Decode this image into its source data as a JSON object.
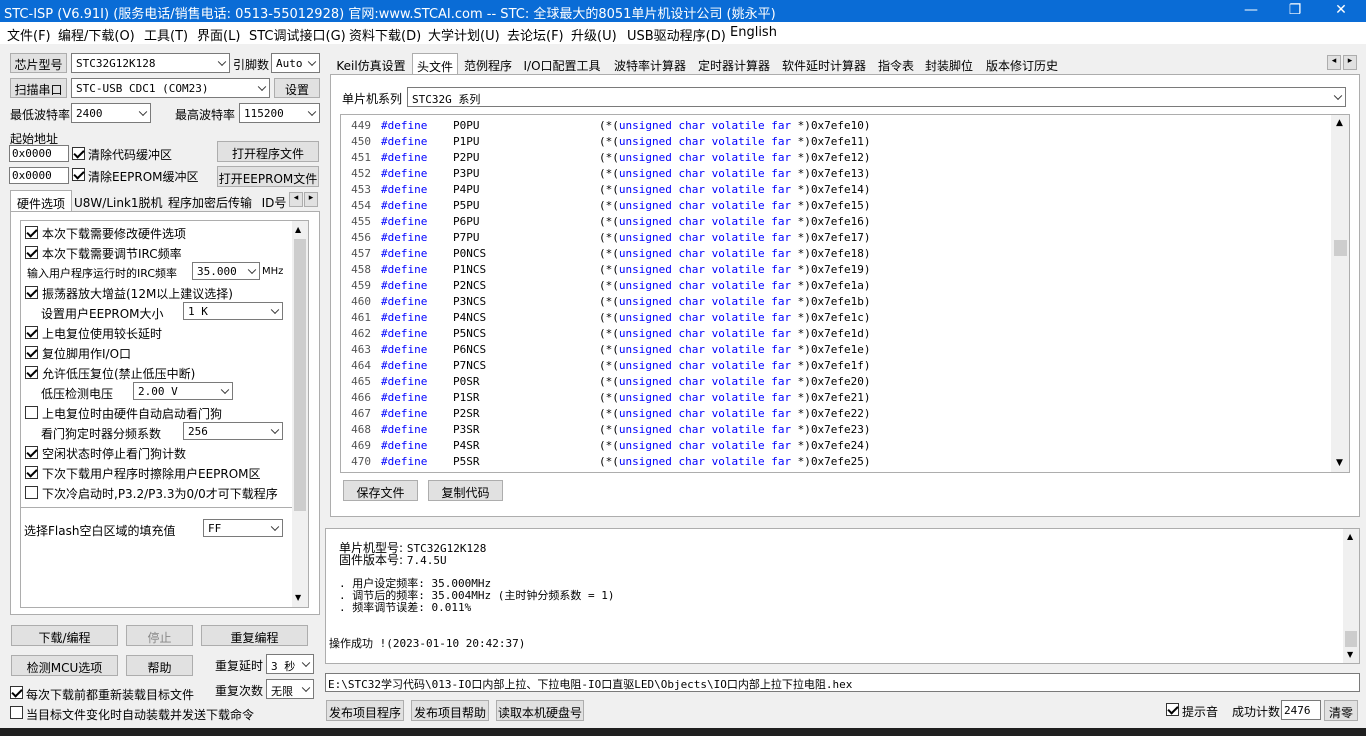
{
  "window": {
    "title": "STC-ISP (V6.91I) (服务电话/销售电话: 0513-55012928) 官网:www.STCAI.com  -- STC: 全球最大的8051单片机设计公司 (姚永平)",
    "minimize": "—",
    "maximize": "❐",
    "close": "✕"
  },
  "menu": [
    "文件(F)",
    "编程/下载(O)",
    "工具(T)",
    "界面(L)",
    "STC调试接口(G)",
    "资料下载(D)",
    "大学计划(U)",
    "去论坛(F)",
    "升级(U)",
    "USB驱动程序(D)",
    "English"
  ],
  "left": {
    "chip_button": "芯片型号",
    "chip_value": "STC32G12K128",
    "pin_label": "引脚数",
    "pin_value": "Auto",
    "scan_button": "扫描串口",
    "port_value": "STC-USB CDC1 (COM23)",
    "settings_button": "设置",
    "min_baud_label": "最低波特率",
    "min_baud_value": "2400",
    "max_baud_label": "最高波特率",
    "max_baud_value": "115200",
    "start_addr_label": "起始地址",
    "addr1": "0x0000",
    "clear_code_label": "清除代码缓冲区",
    "open_prog_button": "打开程序文件",
    "addr2": "0x0000",
    "clear_eeprom_label": "清除EEPROM缓冲区",
    "open_eeprom_button": "打开EEPROM文件",
    "tabs": [
      "硬件选项",
      "U8W/Link1脱机",
      "程序加密后传输",
      "ID号"
    ],
    "hw": {
      "opt1": "本次下载需要修改硬件选项",
      "opt2": "本次下载需要调节IRC频率",
      "irc_label": "输入用户程序运行时的IRC频率",
      "irc_value": "35.000",
      "irc_unit": "MHz",
      "opt3": "振荡器放大增益(12M以上建议选择)",
      "eeprom_label": "设置用户EEPROM大小",
      "eeprom_value": "1   K",
      "opt4": "上电复位使用较长延时",
      "opt5": "复位脚用作I/O口",
      "opt6": "允许低压复位(禁止低压中断)",
      "lvd_label": "低压检测电压",
      "lvd_value": "2.00 V",
      "opt7": "上电复位时由硬件自动启动看门狗",
      "wdt_label": "看门狗定时器分频系数",
      "wdt_value": "256",
      "opt8": "空闲状态时停止看门狗计数",
      "opt9": "下次下载用户程序时擦除用户EEPROM区",
      "opt10": "下次冷启动时,P3.2/P3.3为0/0才可下载程序",
      "fill_label": "选择Flash空白区域的填充值",
      "fill_value": "FF"
    },
    "download_button": "下载/编程",
    "stop_button": "停止",
    "reprogram_button": "重复编程",
    "check_mcu_button": "检测MCU选项",
    "help_button": "帮助",
    "repeat_delay_label": "重复延时",
    "repeat_delay_value": "3 秒",
    "repeat_count_label": "重复次数",
    "repeat_count_value": "无限",
    "reload_label": "每次下载前都重新装载目标文件",
    "auto_send_label": "当目标文件变化时自动装载并发送下载命令"
  },
  "right": {
    "tabs": [
      "Keil仿真设置",
      "头文件",
      "范例程序",
      "I/O口配置工具",
      "波特率计算器",
      "定时器计算器",
      "软件延时计算器",
      "指令表",
      "封装脚位",
      "版本修订历史"
    ],
    "series_label": "单片机系列",
    "series_value": "STC32G 系列",
    "code_lines": [
      {
        "n": "449",
        "name": "P0PU",
        "addr": "0x7efe10"
      },
      {
        "n": "450",
        "name": "P1PU",
        "addr": "0x7efe11"
      },
      {
        "n": "451",
        "name": "P2PU",
        "addr": "0x7efe12"
      },
      {
        "n": "452",
        "name": "P3PU",
        "addr": "0x7efe13"
      },
      {
        "n": "453",
        "name": "P4PU",
        "addr": "0x7efe14"
      },
      {
        "n": "454",
        "name": "P5PU",
        "addr": "0x7efe15"
      },
      {
        "n": "455",
        "name": "P6PU",
        "addr": "0x7efe16"
      },
      {
        "n": "456",
        "name": "P7PU",
        "addr": "0x7efe17"
      },
      {
        "n": "457",
        "name": "P0NCS",
        "addr": "0x7efe18"
      },
      {
        "n": "458",
        "name": "P1NCS",
        "addr": "0x7efe19"
      },
      {
        "n": "459",
        "name": "P2NCS",
        "addr": "0x7efe1a"
      },
      {
        "n": "460",
        "name": "P3NCS",
        "addr": "0x7efe1b"
      },
      {
        "n": "461",
        "name": "P4NCS",
        "addr": "0x7efe1c"
      },
      {
        "n": "462",
        "name": "P5NCS",
        "addr": "0x7efe1d"
      },
      {
        "n": "463",
        "name": "P6NCS",
        "addr": "0x7efe1e"
      },
      {
        "n": "464",
        "name": "P7NCS",
        "addr": "0x7efe1f"
      },
      {
        "n": "465",
        "name": "P0SR",
        "addr": "0x7efe20"
      },
      {
        "n": "466",
        "name": "P1SR",
        "addr": "0x7efe21"
      },
      {
        "n": "467",
        "name": "P2SR",
        "addr": "0x7efe22"
      },
      {
        "n": "468",
        "name": "P3SR",
        "addr": "0x7efe23"
      },
      {
        "n": "469",
        "name": "P4SR",
        "addr": "0x7efe24"
      },
      {
        "n": "470",
        "name": "P5SR",
        "addr": "0x7efe25"
      }
    ],
    "define_kw": "#define",
    "type_text": "unsigned char volatile far",
    "save_button": "保存文件",
    "copy_button": "复制代码",
    "log": {
      "model_label": "单片机型号: ",
      "model_value": "STC32G12K128",
      "fw_label": "固件版本号: ",
      "fw_value": "7.4.5U",
      "set_freq": ". 用户设定频率: 35.000MHz",
      "adj_freq": ". 调节后的频率: 35.004MHz (主时钟分频系数 = 1)",
      "freq_err": ". 频率调节误差: 0.011%",
      "success": "操作成功 !(2023-01-10 20:42:37)"
    },
    "path": "E:\\STC32学习代码\\013-IO口内部上拉、下拉电阻-IO口直驱LED\\Objects\\IO口内部上拉下拉电阻.hex",
    "publish_prog_button": "发布项目程序",
    "publish_help_button": "发布项目帮助",
    "read_disk_button": "读取本机硬盘号",
    "hint_label": "提示音",
    "success_count_label": "成功计数",
    "success_count_value": "2476",
    "clear_button": "清零"
  }
}
